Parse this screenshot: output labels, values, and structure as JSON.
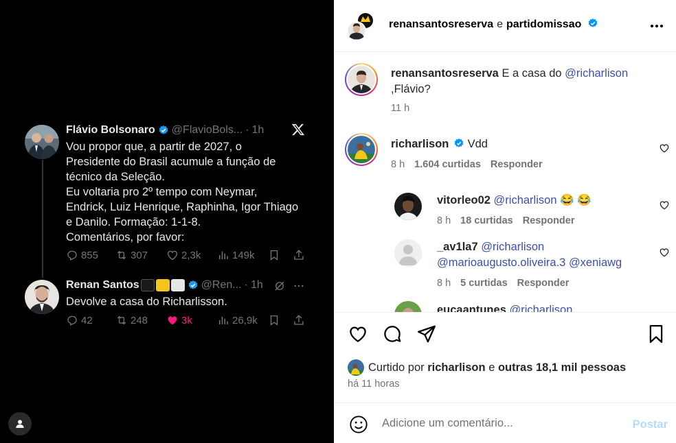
{
  "media": {
    "tweet1": {
      "name": "Flávio Bolsonaro",
      "handle": "@FlavioBols...",
      "sep": "·",
      "time": "1h",
      "text": "Vou propor que, a partir de 2027, o\nPresidente do Brasil acumule a função de\ntécnico da Seleção.\nEu voltaria pro 2º tempo com Neymar,\nEndrick, Luiz Henrique, Raphinha, Igor Thiago\ne Danilo. Formação: 1-1-8.\nComentários, por favor:",
      "replies": "855",
      "retweets": "307",
      "likes": "2,3k",
      "views": "149k"
    },
    "tweet2": {
      "name": "Renan Santos",
      "handle": "@Ren...",
      "sep": "·",
      "time": "1h",
      "text": "Devolve a casa do Richarlisson.",
      "replies": "42",
      "retweets": "248",
      "likes": "3k",
      "views": "26,9k"
    },
    "colors": {
      "like_active": "#f91880",
      "verified": "#1d9bf0"
    }
  },
  "header": {
    "user1": "renansantosreserva",
    "conjunction": "e",
    "user2": "partidomissao"
  },
  "caption": {
    "username": "renansantosreserva",
    "text_before": "E a casa do",
    "mention": "@richarlison",
    "text_after": ",Flávio?",
    "time": "11 h"
  },
  "comments": [
    {
      "username": "richarlison",
      "text": "Vdd",
      "time": "8 h",
      "likes": "1.604 curtidas",
      "reply": "Responder"
    },
    {
      "username": "vitorleo02",
      "mention": "@richarlison",
      "emoji": "😂 😂",
      "time": "8 h",
      "likes": "18 curtidas",
      "reply": "Responder"
    },
    {
      "username": "_av1la7",
      "mention": "@richarlison",
      "mention2": "@marioaugusto.oliveira.3",
      "mention3": "@xeniawg",
      "time": "8 h",
      "likes": "5 curtidas",
      "reply": "Responder"
    },
    {
      "username": "eucaantunes",
      "mention": "@richarlison"
    }
  ],
  "likes_summary": {
    "prefix": "Curtido por",
    "user": "richarlison",
    "conj": "e",
    "others": "outras 18,1 mil pessoas"
  },
  "posted": "há 11 horas",
  "add_comment": {
    "placeholder": "Adicione um comentário...",
    "post_label": "Postar"
  },
  "colors": {
    "mention": "#3d4fa8",
    "verified": "#0095f6",
    "post_disabled": "#b3dbff"
  }
}
